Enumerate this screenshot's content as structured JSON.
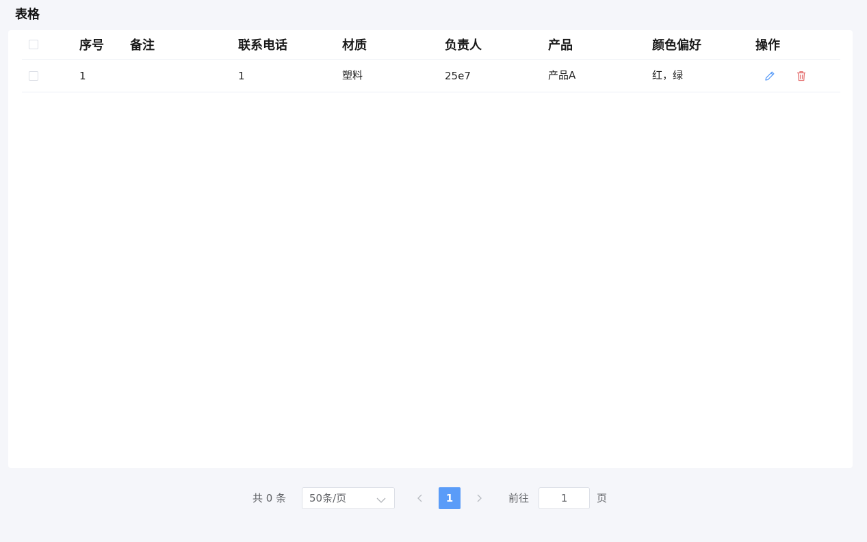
{
  "page": {
    "title": "表格"
  },
  "table": {
    "headers": {
      "index": "序号",
      "remark": "备注",
      "phone": "联系电话",
      "material": "材质",
      "owner": "负责人",
      "product": "产品",
      "color": "颜色偏好",
      "actions": "操作"
    },
    "rows": [
      {
        "index": "1",
        "remark": "",
        "phone": "1",
        "material": "塑料",
        "owner": "25e7",
        "product": "产品A",
        "color": "红，绿"
      }
    ],
    "action_icons": [
      "edit-icon",
      "delete-icon"
    ],
    "colors": {
      "edit": "#5a9cf8",
      "delete": "#e57373"
    }
  },
  "pagination": {
    "total_label": "共 0 条",
    "page_size": "50条/页",
    "current_page": "1",
    "goto_label": "前往",
    "goto_value": "1",
    "page_suffix": "页",
    "active_color": "#5a9cf8"
  }
}
